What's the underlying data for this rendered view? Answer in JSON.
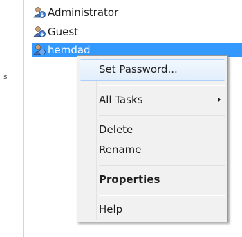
{
  "left_pane": {
    "label": "s"
  },
  "users": [
    {
      "name": "Administrator",
      "icon": "user-account-icon"
    },
    {
      "name": "Guest",
      "icon": "user-account-icon"
    },
    {
      "name": "hemdad",
      "icon": "user-account-icon",
      "selected": true
    }
  ],
  "context_menu": {
    "items": [
      {
        "label": "Set Password..."
      },
      {
        "label": "All Tasks",
        "has_submenu": true
      },
      {
        "label": "Delete"
      },
      {
        "label": "Rename"
      },
      {
        "label": "Properties",
        "bold": true
      },
      {
        "label": "Help"
      }
    ]
  },
  "colors": {
    "selection": "#3399ff",
    "menu_background": "#f1f1f1",
    "menu_border": "#979797",
    "hover_border": "#aecff7"
  }
}
